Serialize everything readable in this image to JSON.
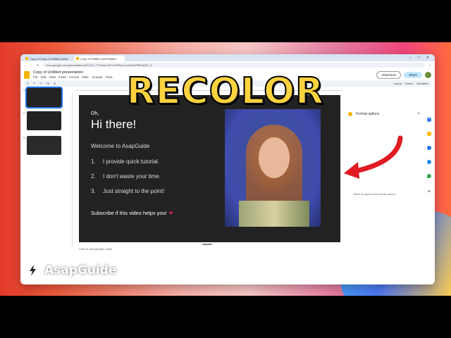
{
  "browser": {
    "tabs": [
      {
        "label": "Copy of Copy of Untitled prese"
      },
      {
        "label": "Copy of Untitled presentation"
      }
    ],
    "url": "docs.google.com/presentation/d/1CsN_TTFkww7XFoYwtPfaf-uuvpSd4vPBoeDbE_1/"
  },
  "app": {
    "title": "Copy of Untitled presentation",
    "menus": [
      "File",
      "Edit",
      "View",
      "Insert",
      "Format",
      "Slide",
      "Arrange",
      "Tools"
    ],
    "slideshow_label": "Slideshow",
    "share_label": "Share"
  },
  "toolbar": {
    "zoom_label": "Fit",
    "items": [
      "Layout",
      "Theme",
      "Transition"
    ]
  },
  "filmstrip": {
    "numbers": [
      "1",
      "2",
      "3"
    ]
  },
  "slide": {
    "oh": "Oh,",
    "hi_there": "Hi there!",
    "welcome": "Welcome to AsapGuide",
    "points": [
      {
        "num": "1.",
        "text": "I provide quick tutorial."
      },
      {
        "num": "2.",
        "text": "I don't waste your time."
      },
      {
        "num": "3.",
        "text": "Just straight to the point!"
      }
    ],
    "subscribe": "Subscribe if this video helps you!",
    "heart": "❤"
  },
  "notes": "Click to add speaker notes",
  "format_panel": {
    "title": "Format options",
    "message": "Select an object to see format options"
  },
  "overlay": {
    "headline": "RECOLOR",
    "brand": "AsapGuide"
  },
  "colors": {
    "headline": "#ffd23f",
    "arrow": "#e01b24",
    "slide_bg": "#222222",
    "share_bg": "#c2e7ff"
  }
}
